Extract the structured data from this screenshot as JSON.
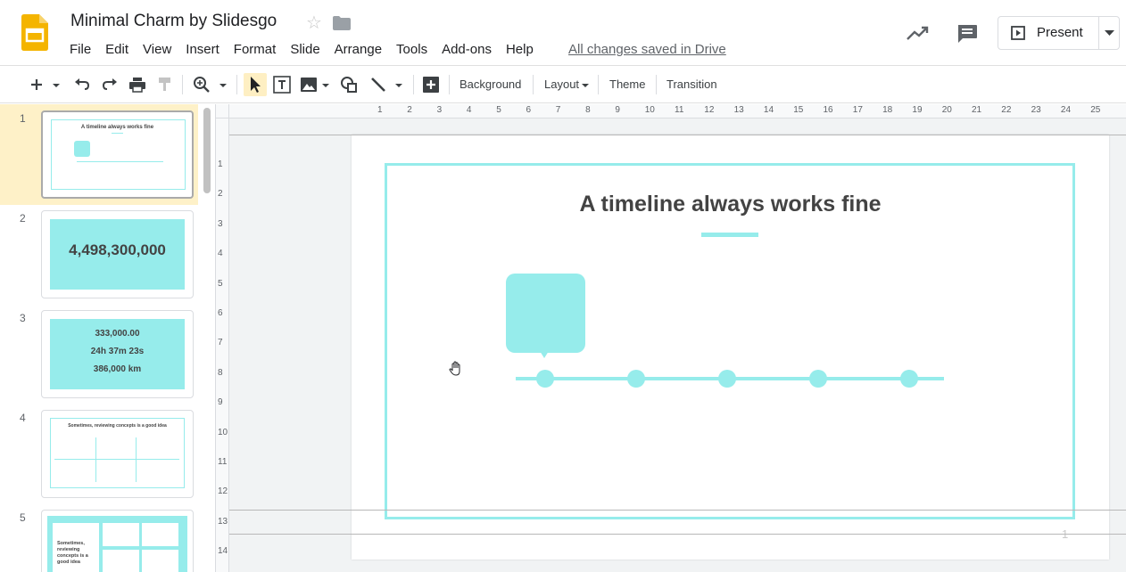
{
  "header": {
    "title": "Minimal Charm by Slidesgo",
    "save_status": "All changes saved in Drive",
    "present_label": "Present",
    "menu": [
      "File",
      "Edit",
      "View",
      "Insert",
      "Format",
      "Slide",
      "Arrange",
      "Tools",
      "Add-ons",
      "Help"
    ]
  },
  "toolbar": {
    "background_label": "Background",
    "layout_label": "Layout",
    "theme_label": "Theme",
    "transition_label": "Transition"
  },
  "ruler": {
    "top_numbers": [
      "1",
      "2",
      "3",
      "4",
      "5",
      "6",
      "7",
      "8",
      "9",
      "10",
      "11",
      "12",
      "13",
      "14",
      "15",
      "16",
      "17",
      "18",
      "19",
      "20",
      "21",
      "22",
      "23",
      "24",
      "25"
    ],
    "left_numbers": [
      "1",
      "2",
      "3",
      "4",
      "5",
      "6",
      "7",
      "8",
      "9",
      "10",
      "11",
      "12",
      "13",
      "14"
    ]
  },
  "slides": [
    {
      "number": "1",
      "title": "A timeline always works fine"
    },
    {
      "number": "2",
      "big_number": "4,498,300,000"
    },
    {
      "number": "3",
      "values": [
        "333,000.00",
        "24h 37m 23s",
        "386,000 km"
      ]
    },
    {
      "number": "4",
      "title": "Sometimes, reviewing concepts is a good idea"
    },
    {
      "number": "5",
      "title": "Sometimes, reviewing concepts is a good idea"
    }
  ],
  "slide": {
    "title": "A timeline always works fine",
    "page_number": "1"
  },
  "colors": {
    "accent": "#96eceb",
    "title_text": "#434343",
    "selection": "#fef1c8"
  }
}
